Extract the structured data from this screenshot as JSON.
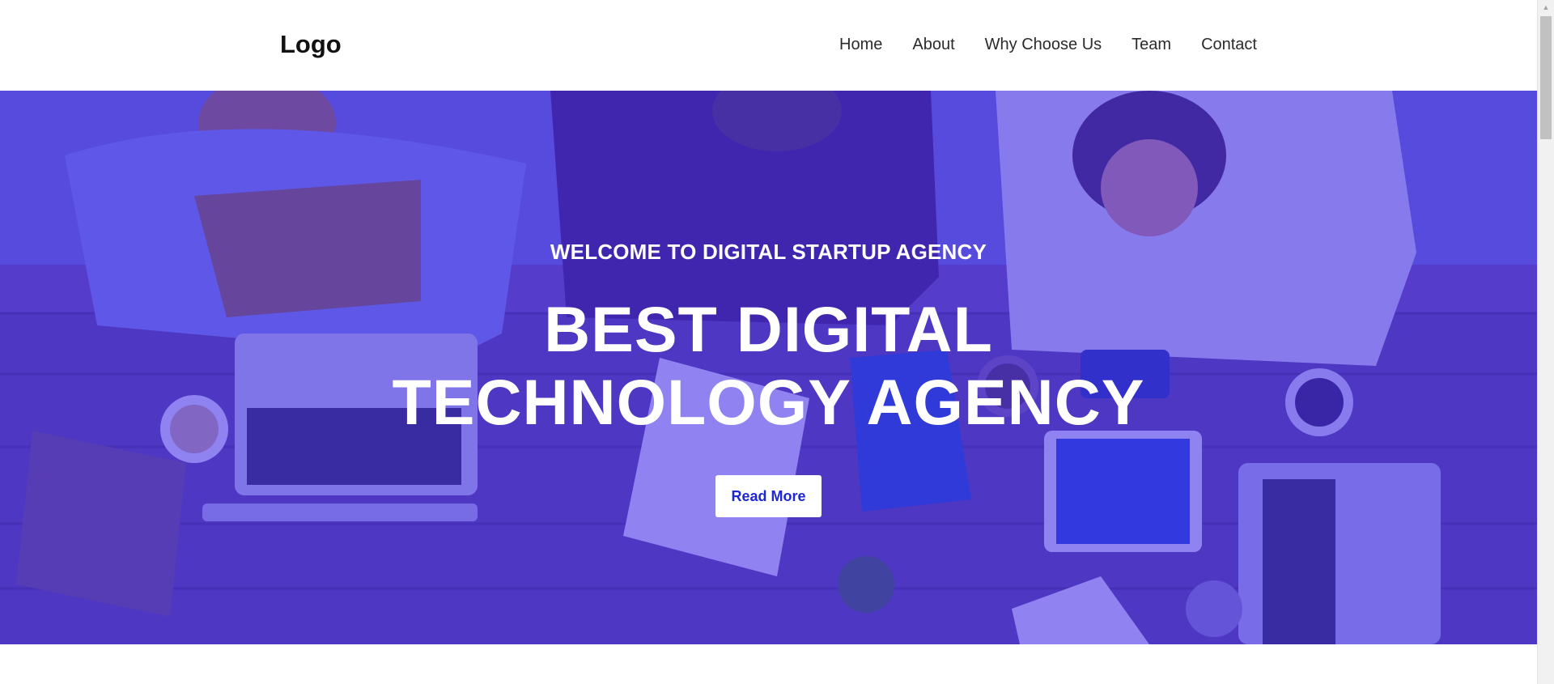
{
  "header": {
    "logo": "Logo",
    "nav": [
      {
        "label": "Home"
      },
      {
        "label": "About"
      },
      {
        "label": "Why Choose Us"
      },
      {
        "label": "Team"
      },
      {
        "label": "Contact"
      }
    ]
  },
  "hero": {
    "subtitle": "WELCOME TO DIGITAL STARTUP AGENCY",
    "title": "BEST DIGITAL TECHNOLOGY AGENCY",
    "button_label": "Read More",
    "background": "people-working-at-table-photo",
    "overlay_color": "#4632e6"
  },
  "colors": {
    "accent": "#1d27d6",
    "text_dark": "#111111"
  },
  "icons": {
    "scroll_up": "scroll-up-arrow-icon"
  }
}
